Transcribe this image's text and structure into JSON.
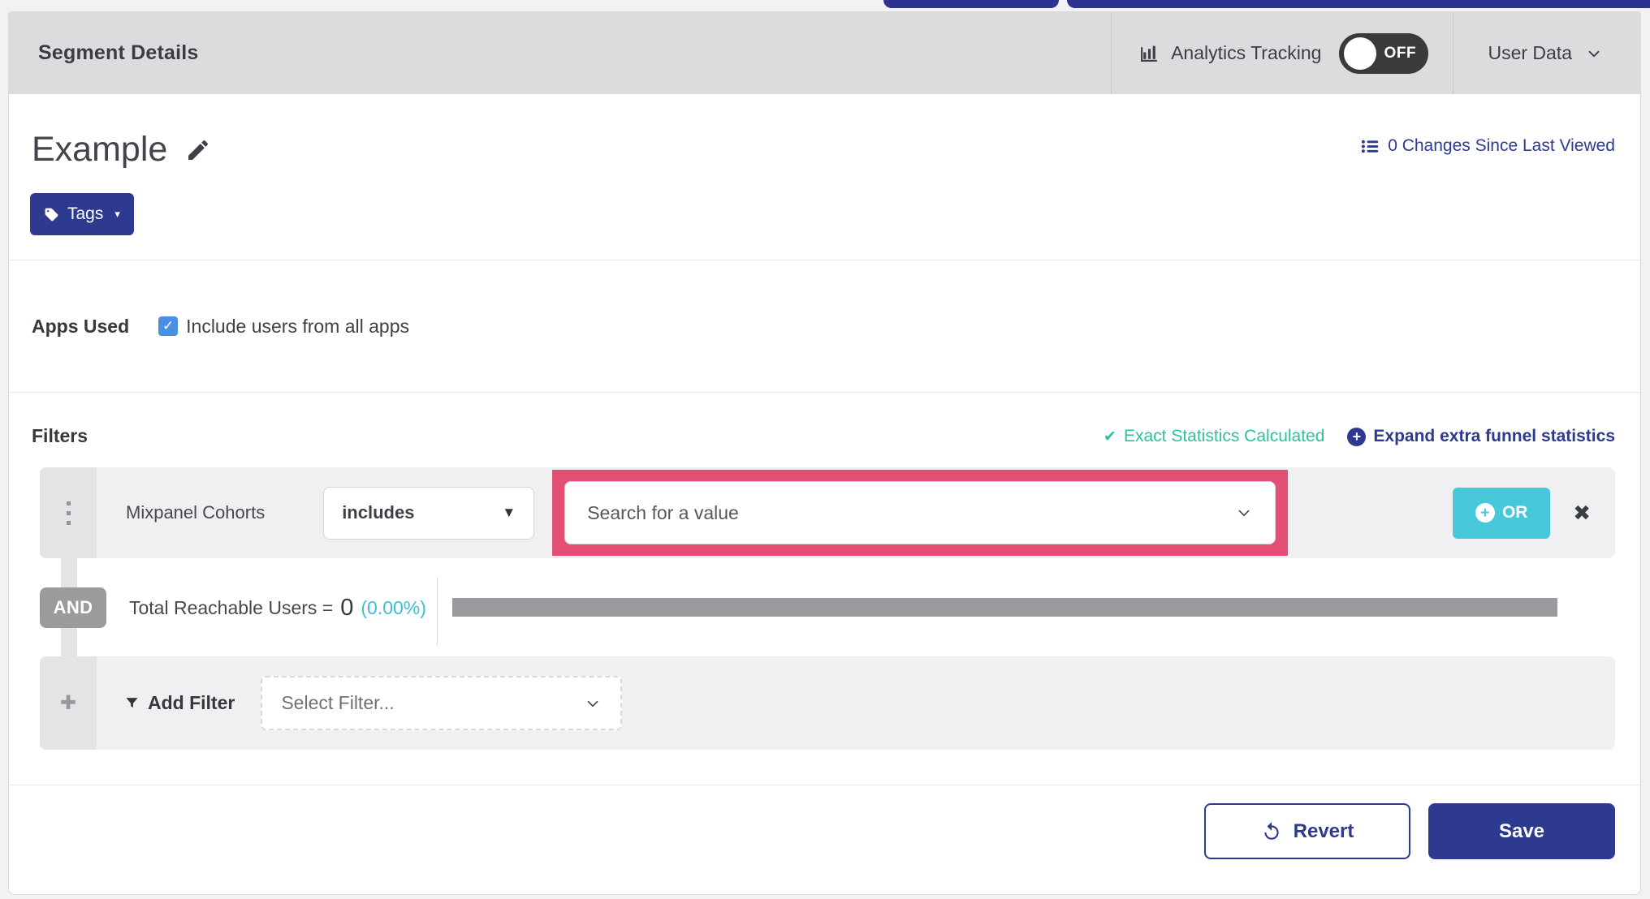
{
  "header": {
    "title": "Segment Details",
    "analytics_label": "Analytics Tracking",
    "toggle_state": "OFF",
    "user_data_label": "User Data"
  },
  "segment": {
    "name": "Example",
    "tags_label": "Tags",
    "changes_link": "0 Changes Since Last Viewed"
  },
  "apps_used": {
    "label": "Apps Used",
    "checkbox_checked": true,
    "checkbox_label": "Include users from all apps"
  },
  "filters": {
    "title": "Filters",
    "exact_stats": "Exact Statistics Calculated",
    "expand_link": "Expand extra funnel statistics",
    "row": {
      "field": "Mixpanel Cohorts",
      "operator": "includes",
      "value_placeholder": "Search for a value",
      "or_label": "OR"
    },
    "and_label": "AND",
    "total": {
      "label": "Total Reachable Users =",
      "value": "0",
      "percent": "(0.00%)"
    },
    "add": {
      "label": "Add Filter",
      "placeholder": "Select Filter..."
    }
  },
  "footer": {
    "revert_label": "Revert",
    "save_label": "Save"
  },
  "icons": {
    "check": "✓",
    "heavy_check": "✔",
    "close": "✖",
    "caret_down": "▼",
    "caret_small": "▾",
    "plus": "+",
    "heavy_plus": "✚"
  },
  "colors": {
    "accent_navy": "#2d3a8f",
    "highlight_pink": "#e24f72",
    "or_teal": "#47c8da",
    "stats_teal": "#2fc19c",
    "percent_cyan": "#3bbfd4",
    "checkbox_blue": "#4a90e2",
    "header_gray": "#dcdcdf",
    "row_gray": "#f0f0f2",
    "bar_gray": "#9a9a9e",
    "toggle_dark": "#3a3a3c"
  }
}
